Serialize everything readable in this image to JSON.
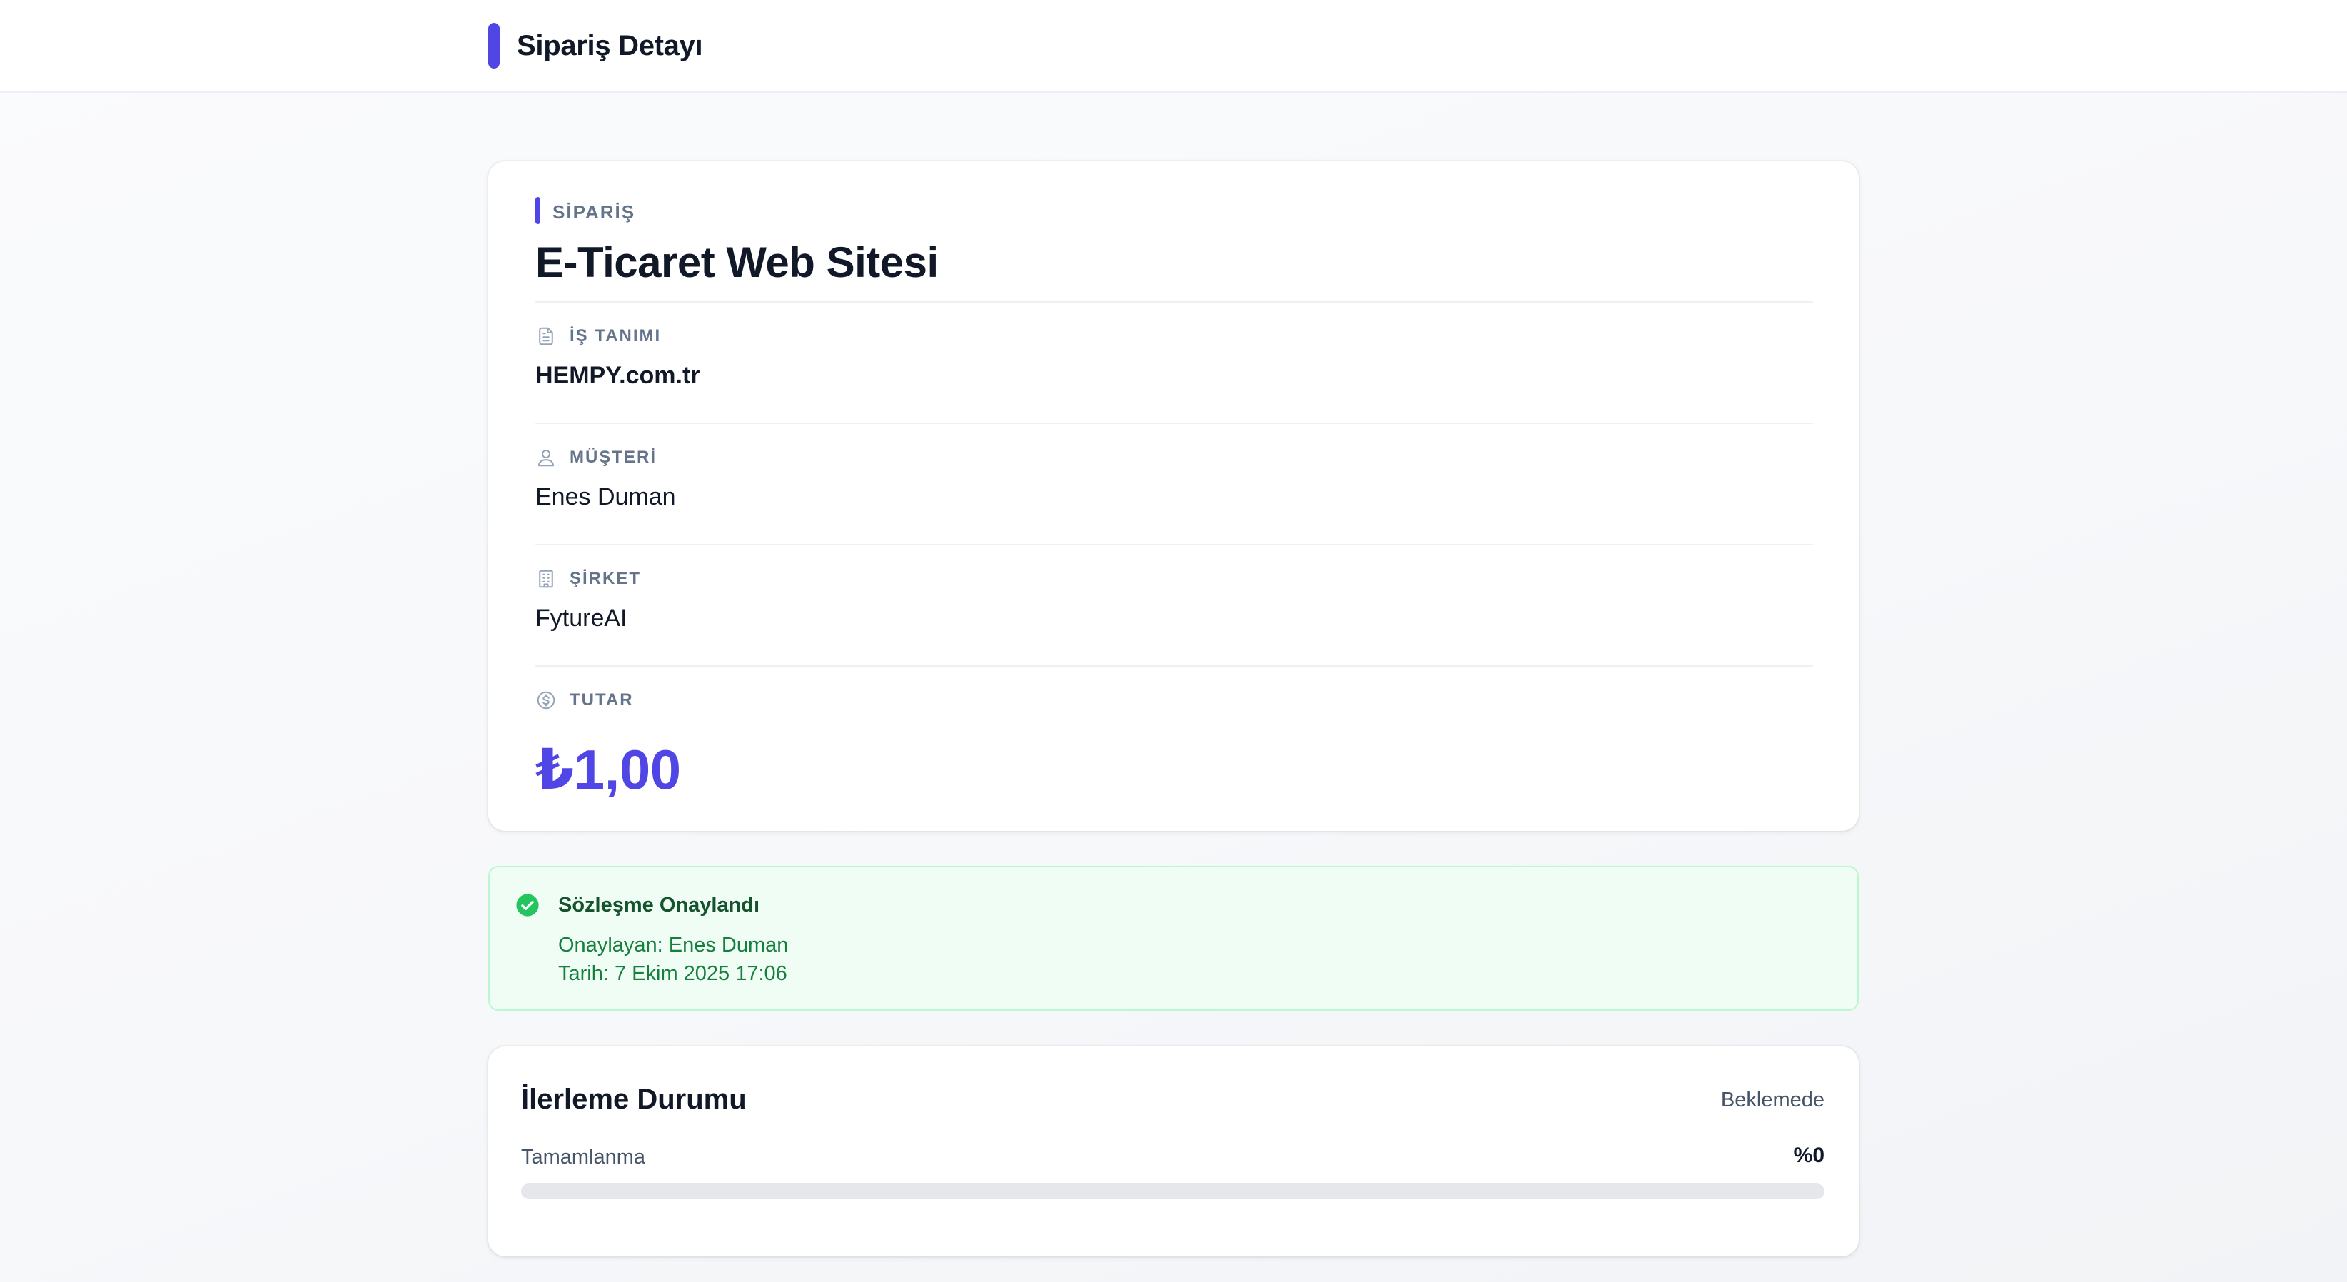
{
  "header": {
    "title": "Sipariş Detayı"
  },
  "order": {
    "section_label": "SİPARİŞ",
    "title": "E-Ticaret Web Sitesi",
    "fields": [
      {
        "label": "İŞ TANIMI",
        "value": "HEMPY.com.tr",
        "icon": "document-icon"
      },
      {
        "label": "MÜŞTERİ",
        "value": "Enes Duman",
        "icon": "user-icon"
      },
      {
        "label": "ŞİRKET",
        "value": "FytureAI",
        "icon": "building-icon"
      },
      {
        "label": "TUTAR",
        "value": "₺1,00",
        "icon": "currency-icon"
      }
    ]
  },
  "approval": {
    "title": "Sözleşme Onaylandı",
    "approved_by": "Onaylayan: Enes Duman",
    "date": "Tarih: 7 Ekim 2025 17:06",
    "icon": "check-circle-icon"
  },
  "progress": {
    "title": "İlerleme Durumu",
    "status": "Beklemede",
    "label": "Tamamlanma",
    "percent_text": "%0",
    "percent": 0
  },
  "colors": {
    "accent": "#4f46e5",
    "success_bg": "#f0fdf4",
    "success_icon": "#22c55e",
    "success_text": "#15803d"
  }
}
